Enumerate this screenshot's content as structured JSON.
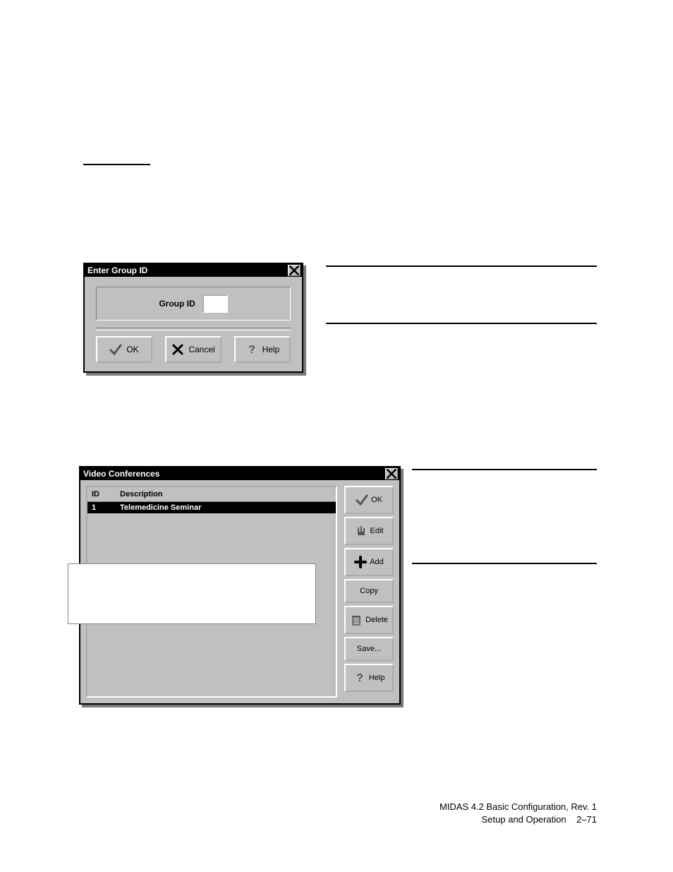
{
  "dlg1": {
    "title": "Enter Group ID",
    "field_label": "Group ID",
    "field_value": "",
    "buttons": {
      "ok": "OK",
      "cancel": "Cancel",
      "help": "Help"
    }
  },
  "dlg2": {
    "title": "Video Conferences",
    "columns": {
      "id": "ID",
      "description": "Description"
    },
    "rows": [
      {
        "id": "1",
        "description": "Telemedicine Seminar"
      }
    ],
    "buttons": {
      "ok": "OK",
      "edit": "Edit",
      "add": "Add",
      "copy": "Copy",
      "delete": "Delete",
      "save": "Save...",
      "help": "Help"
    }
  },
  "footer": {
    "line1": "MIDAS 4.2 Basic Configuration, Rev. 1",
    "line2_text": "Setup and Operation",
    "page": "2–71"
  }
}
